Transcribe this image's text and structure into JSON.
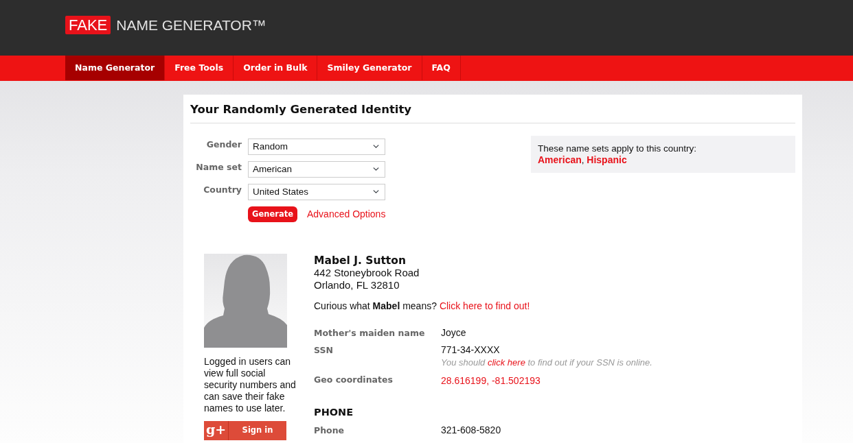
{
  "logo": {
    "badge": "FAKE",
    "text": "NAME GENERATOR™"
  },
  "nav": [
    {
      "label": "Name Generator",
      "selected": true
    },
    {
      "label": "Free Tools",
      "selected": false
    },
    {
      "label": "Order in Bulk",
      "selected": false
    },
    {
      "label": "Smiley Generator",
      "selected": false
    },
    {
      "label": "FAQ",
      "selected": false
    }
  ],
  "panel": {
    "title": "Your Randomly Generated Identity",
    "form": {
      "fields": [
        {
          "label": "Gender",
          "value": "Random"
        },
        {
          "label": "Name set",
          "value": "American"
        },
        {
          "label": "Country",
          "value": "United States"
        }
      ],
      "generate_button": "Generate",
      "advanced_link": "Advanced Options"
    },
    "name_sets_box": {
      "text": "These name sets apply to this country:",
      "links": [
        "American",
        "Hispanic"
      ],
      "separator": ","
    },
    "identity": {
      "login_note": "Logged in users can view full social security numbers and can save their fake names to use later.",
      "sign_in_button": {
        "logo": "g+",
        "label": "Sign in"
      },
      "name": "Mabel J. Sutton",
      "address": [
        "442 Stoneybrook Road",
        "Orlando, FL 32810"
      ],
      "meaning": {
        "prompt": "Curious what **Mabel** means?",
        "link": "Click here to find out!"
      },
      "sections": [
        {
          "rows": [
            {
              "label": "Mother's maiden name",
              "value": "Joyce",
              "kind": "text"
            },
            {
              "label": "SSN",
              "value": "771-34-XXXX",
              "kind": "text",
              "note": {
                "before": "You should",
                "link": "click here",
                "after": "to find out if your SSN is online."
              }
            },
            {
              "label": "Geo coordinates",
              "value": "28.616199, -81.502193",
              "kind": "link"
            }
          ]
        },
        {
          "heading": "PHONE",
          "rows": [
            {
              "label": "Phone",
              "value": "321-608-5820",
              "kind": "text"
            }
          ]
        }
      ]
    }
  }
}
